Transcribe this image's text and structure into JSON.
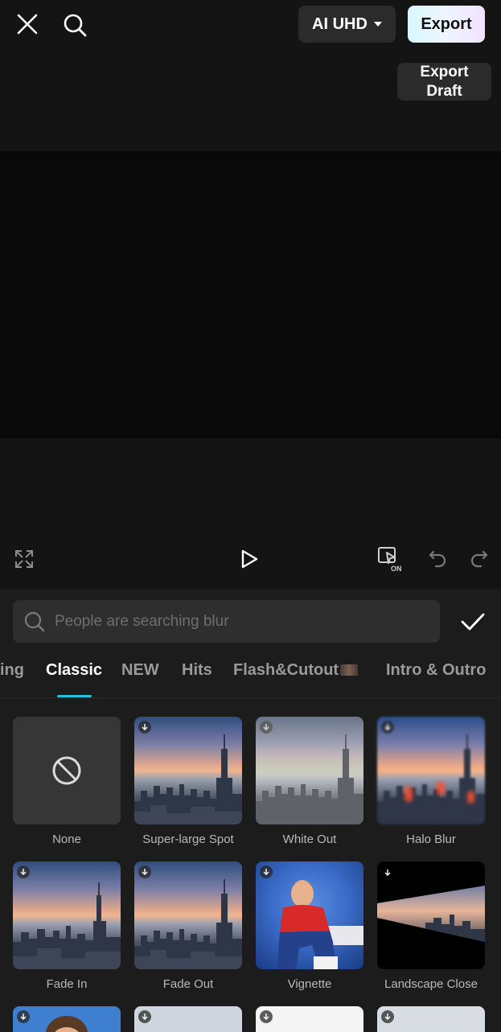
{
  "header": {
    "quality_label": "AI UHD",
    "export_label": "Export",
    "export_draft_label": "Export Draft"
  },
  "search": {
    "placeholder": "People are searching blur"
  },
  "tabs": [
    {
      "label": "ing",
      "active": false
    },
    {
      "label": "Classic",
      "active": true
    },
    {
      "label": "NEW",
      "active": false
    },
    {
      "label": "Hits",
      "active": false
    },
    {
      "label": "Flash&Cutout",
      "active": false
    },
    {
      "label": "Intro & Outro",
      "active": false
    }
  ],
  "effects": [
    {
      "label": "None",
      "downloadable": false
    },
    {
      "label": "Super-large Spot",
      "downloadable": true
    },
    {
      "label": "White Out",
      "downloadable": true
    },
    {
      "label": "Halo Blur",
      "downloadable": true
    },
    {
      "label": "Fade In",
      "downloadable": true
    },
    {
      "label": "Fade Out",
      "downloadable": true
    },
    {
      "label": "Vignette",
      "downloadable": true
    },
    {
      "label": "Landscape Close",
      "downloadable": true
    }
  ],
  "colors": {
    "accent": "#24c3d3",
    "background": "#141414",
    "panel": "#1c1c1c"
  }
}
